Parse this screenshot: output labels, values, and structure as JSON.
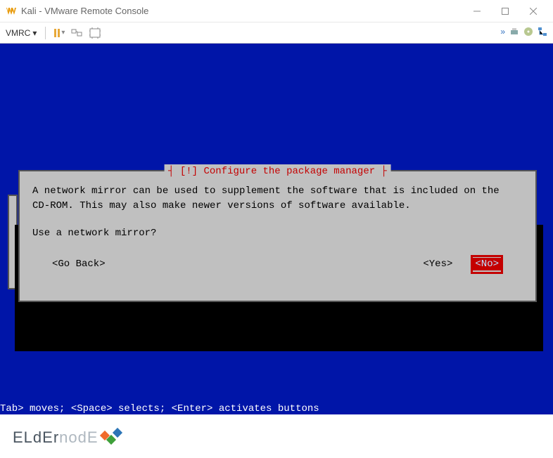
{
  "window": {
    "title": "Kali - VMware Remote Console"
  },
  "toolbar": {
    "vmrc_label": "VMRC"
  },
  "dialog": {
    "title": "┤ [!] Configure the package manager ├",
    "body": "A network mirror can be used to supplement the software that is included on the CD-ROM. This may also make newer versions of software available.",
    "question": "Use a network mirror?",
    "go_back": "<Go Back>",
    "yes": "<Yes>",
    "no": "<No>"
  },
  "footer": {
    "help": "Tab> moves; <Space> selects; <Enter> activates buttons"
  },
  "watermark": {
    "part1": "ELdEr",
    "part2": "nodE"
  }
}
